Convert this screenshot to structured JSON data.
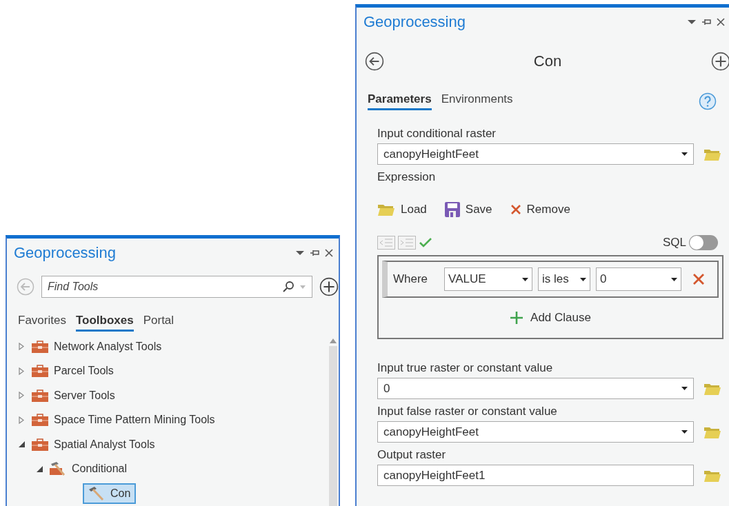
{
  "left_panel": {
    "title": "Geoprocessing",
    "search": {
      "placeholder": "Find Tools"
    },
    "tabs": [
      {
        "label": "Favorites",
        "selected": false
      },
      {
        "label": "Toolboxes",
        "selected": true
      },
      {
        "label": "Portal",
        "selected": false
      }
    ],
    "tree": [
      {
        "label": "Network Analyst Tools",
        "kind": "toolbox",
        "expanded": false
      },
      {
        "label": "Parcel Tools",
        "kind": "toolbox",
        "expanded": false
      },
      {
        "label": "Server Tools",
        "kind": "toolbox",
        "expanded": false
      },
      {
        "label": "Space Time Pattern Mining Tools",
        "kind": "toolbox",
        "expanded": false
      },
      {
        "label": "Spatial Analyst Tools",
        "kind": "toolbox",
        "expanded": true,
        "children": [
          {
            "label": "Conditional",
            "kind": "toolset",
            "expanded": true,
            "children": [
              {
                "label": "Con",
                "kind": "tool",
                "selected": true
              }
            ]
          }
        ]
      }
    ]
  },
  "right_panel": {
    "title": "Geoprocessing",
    "tool_name": "Con",
    "tabs": [
      {
        "label": "Parameters",
        "selected": true
      },
      {
        "label": "Environments",
        "selected": false
      }
    ],
    "parameters": [
      {
        "kind": "dropdown",
        "label": "Input conditional raster",
        "value": "canopyHeightFeet"
      },
      {
        "kind": "expression",
        "label": "Expression"
      },
      {
        "kind": "dropdown",
        "label": "Input true raster or constant value",
        "value": "0"
      },
      {
        "kind": "dropdown",
        "label": "Input false raster or constant value",
        "value": "canopyHeightFeet"
      },
      {
        "kind": "text",
        "label": "Output raster",
        "value": "canopyHeightFeet1"
      }
    ],
    "expression": {
      "actions": [
        {
          "kind": "load",
          "label": "Load"
        },
        {
          "kind": "save",
          "label": "Save"
        },
        {
          "kind": "remove",
          "label": "Remove"
        }
      ],
      "sql": {
        "label": "SQL",
        "on": false
      },
      "clause": {
        "keyword": "Where",
        "field": "VALUE",
        "operator": "is les",
        "value": "0"
      },
      "add_clause": "Add Clause"
    }
  }
}
